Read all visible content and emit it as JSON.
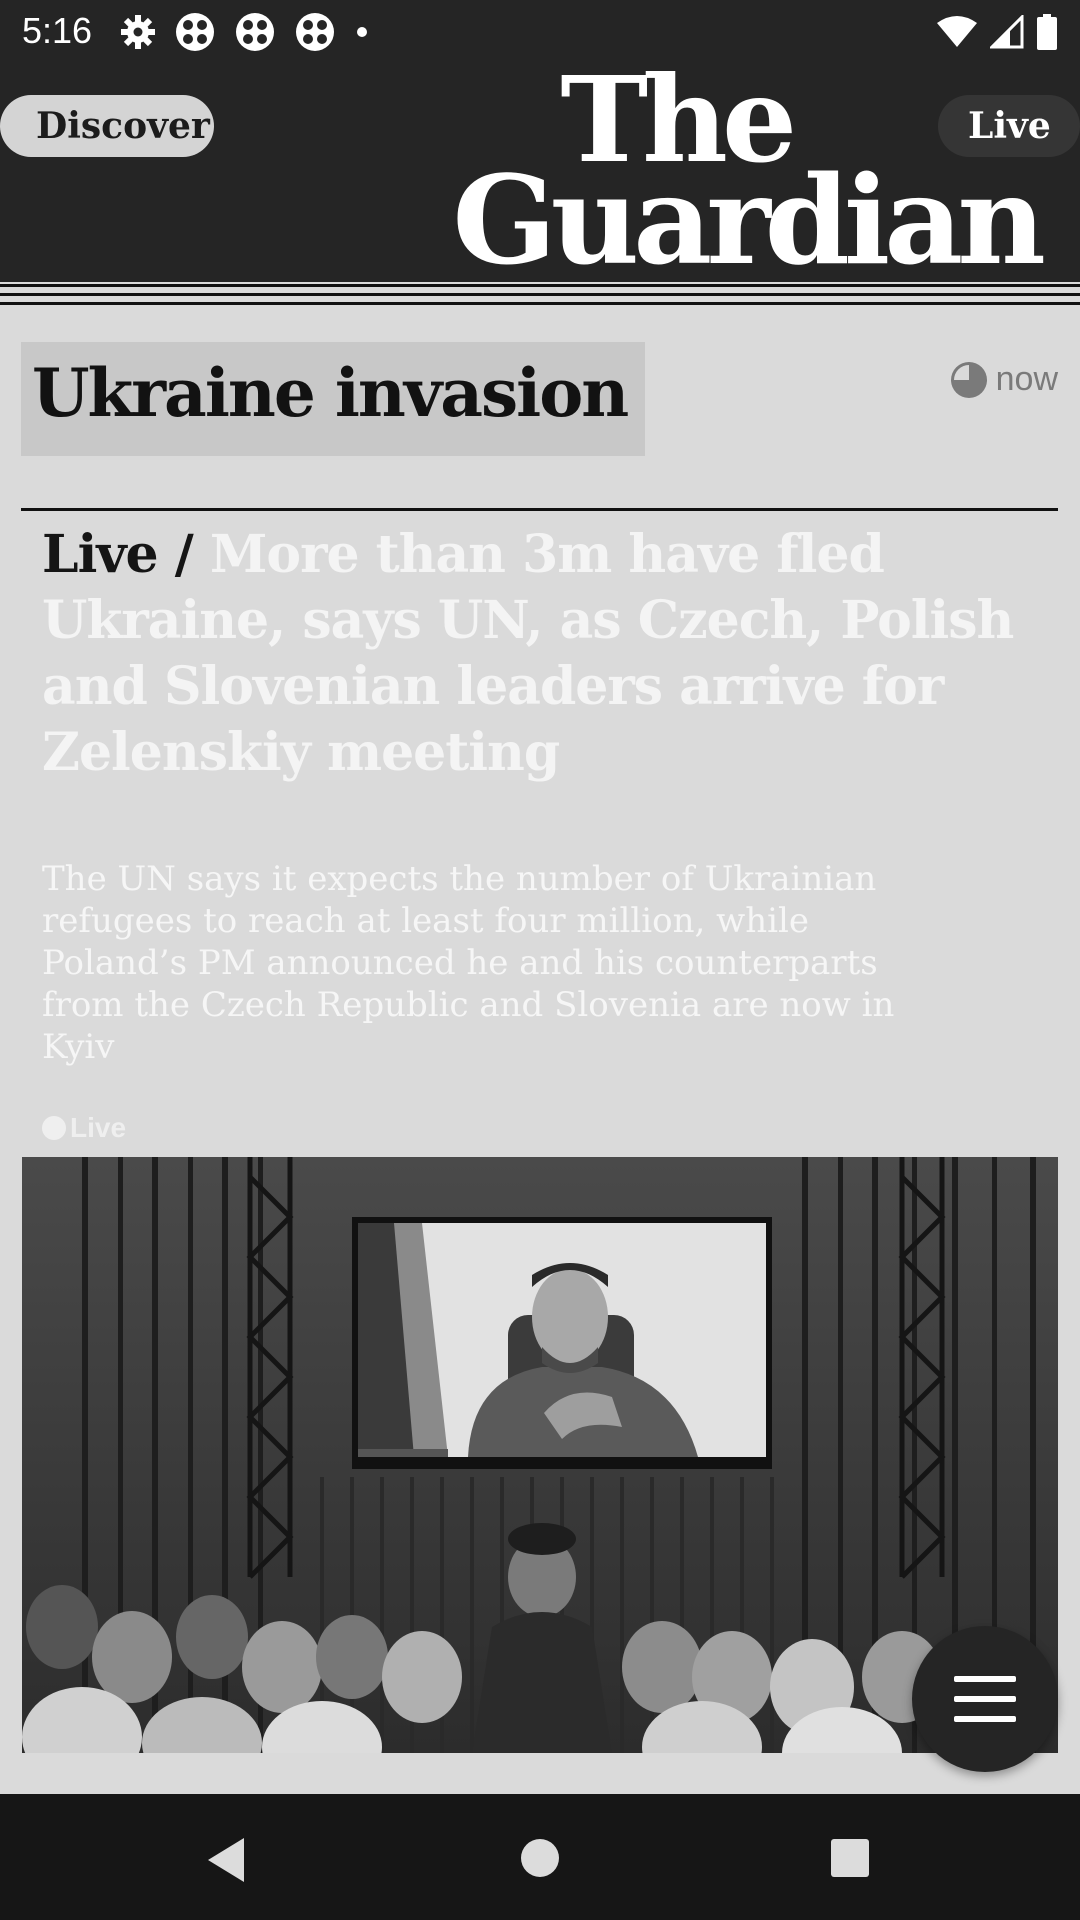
{
  "status_bar": {
    "time": "5:16",
    "icons_left": [
      "gear-icon",
      "app-icon",
      "app-icon",
      "app-icon",
      "dot-icon"
    ],
    "icons_right": [
      "wifi-icon",
      "signal-icon",
      "battery-icon"
    ]
  },
  "header": {
    "discover_label": "Discover",
    "live_label": "Live",
    "logo_line1": "The",
    "logo_line2": "Guardian"
  },
  "article": {
    "kicker": "Ukraine invasion",
    "timestamp": "now",
    "headline_live": "Live /",
    "headline": "More than 3m have fled Ukraine, says UN, as Czech, Polish and Slovenian leaders arrive for Zelenskiy meeting",
    "standfirst": "The UN says it expects the number of Ukrainian refugees to reach at least four million, while Poland’s PM announced he and his counterparts from the Czech Republic and Slovenia are now in Kyiv",
    "live_tag": "Live"
  },
  "colors": {
    "header_bg": "#252525",
    "page_bg": "#dadada",
    "kicker_bg": "#c8c8c8"
  }
}
